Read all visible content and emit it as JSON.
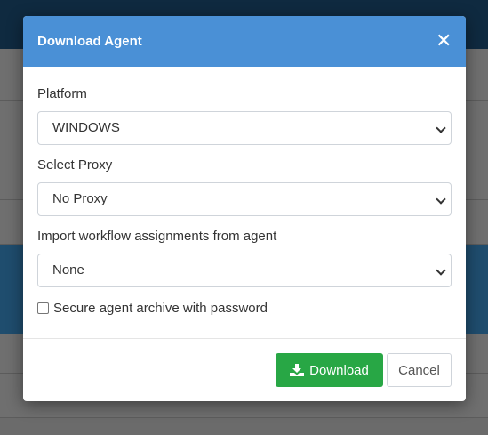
{
  "modal": {
    "title": "Download Agent",
    "close_icon": "close-icon",
    "header_color": "#4a90d6"
  },
  "form": {
    "platform": {
      "label": "Platform",
      "value": "WINDOWS"
    },
    "proxy": {
      "label": "Select Proxy",
      "value": "No Proxy"
    },
    "workflow": {
      "label": "Import workflow assignments from agent",
      "value": "None"
    },
    "secure_archive": {
      "label": "Secure agent archive with password",
      "checked": false
    }
  },
  "footer": {
    "download_label": "Download",
    "download_icon": "download-icon",
    "download_color": "#28a745",
    "cancel_label": "Cancel"
  }
}
